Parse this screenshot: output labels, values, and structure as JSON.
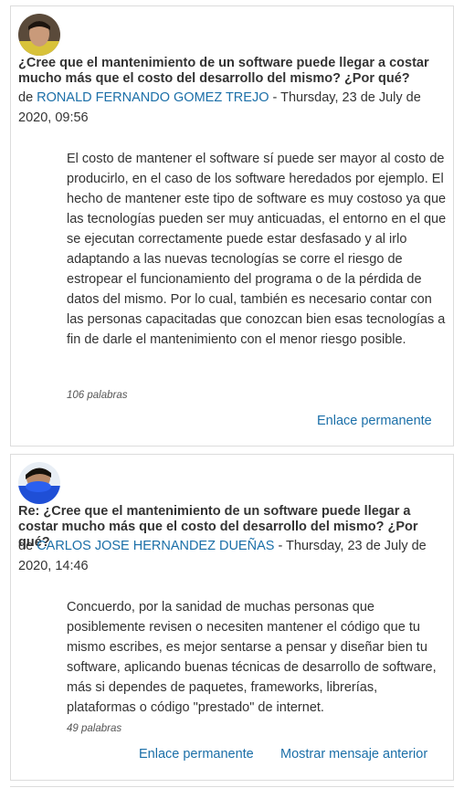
{
  "posts": [
    {
      "subject": "¿Cree que el mantenimiento de un software puede llegar a costar mucho más que el costo del desarrollo del mismo? ¿Por qué?",
      "by_prefix": "de ",
      "author": "RONALD FERNANDO GOMEZ TREJO",
      "date": " - Thursday, 23 de July de 2020, 09:56",
      "body": "El costo de mantener el software sí puede ser mayor al costo de producirlo, en el caso de los software heredados por ejemplo. El hecho de mantener este tipo de software es muy costoso ya que las tecnologías pueden ser muy anticuadas, el entorno en el que se ejecutan correctamente puede estar desfasado y al irlo adaptando a las nuevas tecnologías se corre el riesgo de estropear el funcionamiento del programa o de la pérdida de datos del mismo. Por lo cual, también es necesario contar con las personas capacitadas que conozcan bien esas tecnologías a fin de darle el mantenimiento con el menor riesgo posible.",
      "word_count": "106 palabras",
      "permalink": "Enlace permanente"
    },
    {
      "subject": "Re: ¿Cree que el mantenimiento de un software puede llegar a costar mucho más que el costo del desarrollo del mismo? ¿Por qué?",
      "by_prefix": "de ",
      "author": "CARLOS JOSE HERNANDEZ DUEÑAS",
      "date": " - Thursday, 23 de July de 2020, 14:46",
      "body": "Concuerdo, por la sanidad de muchas personas que posiblemente revisen o necesiten mantener el código que tu mismo escribes, es mejor sentarse a pensar y diseñar bien tu software, aplicando buenas técnicas de desarrollo de software, más si dependes de paquetes, frameworks, librerías, plataformas o código \"prestado\" de internet.",
      "word_count": "49 palabras",
      "permalink": "Enlace permanente",
      "show_parent": "Mostrar mensaje anterior"
    }
  ],
  "colors": {
    "link": "#1b6fa8",
    "border": "#dcdcdc",
    "text": "#333333"
  }
}
